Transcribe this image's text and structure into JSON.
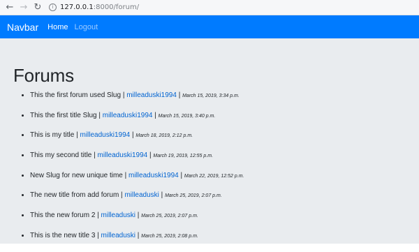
{
  "browser": {
    "back_icon": "arrow-left-icon",
    "forward_icon": "arrow-right-icon",
    "reload_icon": "reload-icon",
    "info_icon": "info-icon",
    "url_host": "127.0.0.1",
    "url_path": ":8000/forum/"
  },
  "navbar": {
    "brand": "Navbar",
    "links": [
      {
        "label": "Home"
      },
      {
        "label": "Logout"
      }
    ]
  },
  "page": {
    "title": "Forums"
  },
  "forums": [
    {
      "title": "This the first forum used Slug",
      "author": "milleaduski1994",
      "date": "March 15, 2019, 3:34 p.m."
    },
    {
      "title": "This the first title Slug",
      "author": "milleaduski1994",
      "date": "March 15, 2019, 3:40 p.m."
    },
    {
      "title": "This is my title",
      "author": "milleaduski1994",
      "date": "March 18, 2019, 2:12 p.m."
    },
    {
      "title": "This my second title",
      "author": "milleaduski1994",
      "date": "March 19, 2019, 12:55 p.m."
    },
    {
      "title": "New Slug for new unique time",
      "author": "milleaduski1994",
      "date": "March 22, 2019, 12:52 p.m."
    },
    {
      "title": "The new title from add forum",
      "author": "milleaduski",
      "date": "March 25, 2019, 2:07 p.m."
    },
    {
      "title": "This the new forum 2",
      "author": "milleaduski",
      "date": "March 25, 2019, 2:07 p.m."
    },
    {
      "title": "This is the new title 3",
      "author": "milleaduski",
      "date": "March 25, 2019, 2:08 p.m."
    }
  ]
}
